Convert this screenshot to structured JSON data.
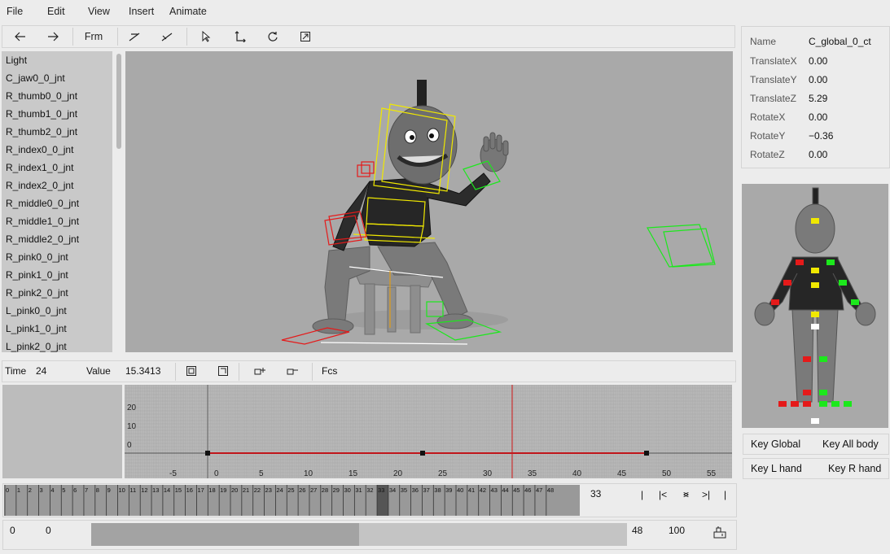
{
  "menu": [
    "File",
    "Edit",
    "View",
    "Insert",
    "Animate"
  ],
  "toolbar": {
    "prev_icon": "arrow-left-icon",
    "next_icon": "arrow-right-icon",
    "frm_label": "Frm",
    "tool_icons": [
      "bone-add-icon",
      "bone-remove-icon",
      "select-arrow-icon",
      "move-icon",
      "rotate-icon",
      "scale-icon"
    ]
  },
  "joints": [
    "Light",
    "C_jaw0_0_jnt",
    "R_thumb0_0_jnt",
    "R_thumb1_0_jnt",
    "R_thumb2_0_jnt",
    "R_index0_0_jnt",
    "R_index1_0_jnt",
    "R_index2_0_jnt",
    "R_middle0_0_jnt",
    "R_middle1_0_jnt",
    "R_middle2_0_jnt",
    "R_pink0_0_jnt",
    "R_pink1_0_jnt",
    "R_pink2_0_jnt",
    "L_pink0_0_jnt",
    "L_pink1_0_jnt",
    "L_pink2_0_jnt"
  ],
  "props": {
    "name_label": "Name",
    "name_value": "C_global_0_ct",
    "rows": [
      {
        "label": "TranslateX",
        "value": "0.00"
      },
      {
        "label": "TranslateY",
        "value": "0.00"
      },
      {
        "label": "TranslateZ",
        "value": "5.29"
      },
      {
        "label": "RotateX",
        "value": "0.00"
      },
      {
        "label": "RotateY",
        "value": "−0.36"
      },
      {
        "label": "RotateZ",
        "value": "0.00"
      }
    ]
  },
  "key_buttons": {
    "global": "Key Global",
    "all_body": "Key All body",
    "l_hand": "Key L hand",
    "r_hand": "Key R hand"
  },
  "timebar": {
    "time_label": "Time",
    "time_value": "24",
    "value_label": "Value",
    "value_value": "15.3413",
    "fcs_label": "Fcs",
    "icons": [
      "frame-all-icon",
      "frame-selected-icon",
      "key-add-icon",
      "key-remove-icon"
    ]
  },
  "graph": {
    "y_ticks": [
      "20",
      "10",
      "0"
    ],
    "x_ticks": [
      "-5",
      "0",
      "5",
      "10",
      "15",
      "20",
      "25",
      "30",
      "35",
      "40",
      "45",
      "50",
      "55"
    ],
    "current_frame_marker": 33,
    "keys": [
      -1,
      23,
      48
    ],
    "colors": {
      "curve": "#c0161b",
      "cursor": "#d11a1a"
    }
  },
  "frames": {
    "labels": [
      "0",
      "1",
      "2",
      "3",
      "4",
      "5",
      "6",
      "7",
      "8",
      "9",
      "10",
      "11",
      "12",
      "13",
      "14",
      "15",
      "16",
      "17",
      "18",
      "19",
      "20",
      "21",
      "22",
      "23",
      "24",
      "25",
      "26",
      "27",
      "28",
      "29",
      "30",
      "31",
      "32",
      "33",
      "34",
      "35",
      "36",
      "37",
      "38",
      "39",
      "40",
      "41",
      "42",
      "43",
      "44",
      "45",
      "46",
      "47",
      "48"
    ],
    "current": "33",
    "highlighted": 33,
    "nav": [
      "|",
      "|<",
      "<",
      ">",
      ">|",
      "|"
    ]
  },
  "range": {
    "start": "0",
    "start2": "0",
    "end": "48",
    "end2": "100",
    "progress": 0.5,
    "icon": "settings-icon"
  }
}
